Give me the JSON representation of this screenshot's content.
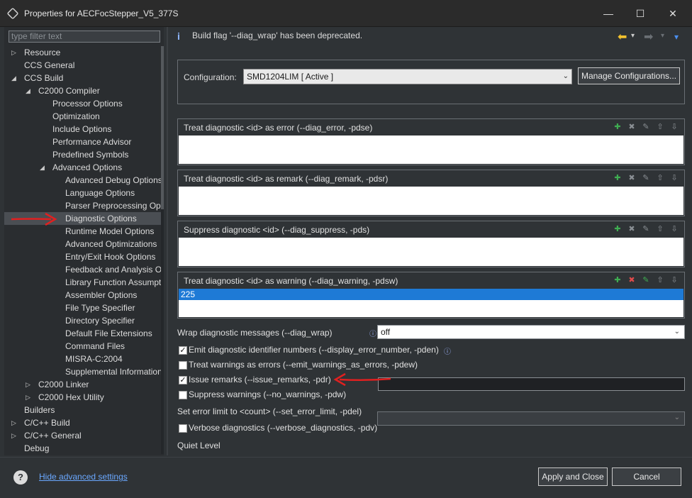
{
  "window": {
    "title": "Properties for AECFocStepper_V5_377S",
    "minimize_glyph": "—",
    "maximize_glyph": "☐",
    "close_glyph": "✕"
  },
  "filter": {
    "placeholder": "type filter text"
  },
  "tree": [
    {
      "label": "Resource",
      "twisty": "▷"
    },
    {
      "label": "CCS General",
      "twisty": ""
    },
    {
      "label": "CCS Build",
      "twisty": "◢"
    },
    {
      "label": "C2000 Compiler",
      "twisty": "◢"
    },
    {
      "label": "Processor Options",
      "twisty": ""
    },
    {
      "label": "Optimization",
      "twisty": ""
    },
    {
      "label": "Include Options",
      "twisty": ""
    },
    {
      "label": "Performance Advisor",
      "twisty": ""
    },
    {
      "label": "Predefined Symbols",
      "twisty": ""
    },
    {
      "label": "Advanced Options",
      "twisty": "◢"
    },
    {
      "label": "Advanced Debug Options",
      "twisty": ""
    },
    {
      "label": "Language Options",
      "twisty": ""
    },
    {
      "label": "Parser Preprocessing Options",
      "twisty": ""
    },
    {
      "label": "Diagnostic Options",
      "twisty": "",
      "selected": true
    },
    {
      "label": "Runtime Model Options",
      "twisty": ""
    },
    {
      "label": "Advanced Optimizations",
      "twisty": ""
    },
    {
      "label": "Entry/Exit Hook Options",
      "twisty": ""
    },
    {
      "label": "Feedback and Analysis Options",
      "twisty": ""
    },
    {
      "label": "Library Function Assumptions",
      "twisty": ""
    },
    {
      "label": "Assembler Options",
      "twisty": ""
    },
    {
      "label": "File Type Specifier",
      "twisty": ""
    },
    {
      "label": "Directory Specifier",
      "twisty": ""
    },
    {
      "label": "Default File Extensions",
      "twisty": ""
    },
    {
      "label": "Command Files",
      "twisty": ""
    },
    {
      "label": "MISRA-C:2004",
      "twisty": ""
    },
    {
      "label": "Supplemental Information",
      "twisty": ""
    },
    {
      "label": "C2000 Linker",
      "twisty": "▷"
    },
    {
      "label": "C2000 Hex Utility",
      "twisty": "▷"
    },
    {
      "label": "Builders",
      "twisty": ""
    },
    {
      "label": "C/C++ Build",
      "twisty": "▷"
    },
    {
      "label": "C/C++ General",
      "twisty": "▷"
    },
    {
      "label": "Debug",
      "twisty": ""
    }
  ],
  "message": {
    "icon": "i",
    "text": "Build flag '--diag_wrap' has been deprecated."
  },
  "nav": {
    "back": "⬅",
    "forward": "➡",
    "menu": "▾"
  },
  "configuration": {
    "label": "Configuration:",
    "value": "SMD1204LIM  [ Active ]",
    "manage_label": "Manage Configurations..."
  },
  "lists": [
    {
      "title": "Treat diagnostic <id> as error (--diag_error, -pdse)",
      "items": []
    },
    {
      "title": "Treat diagnostic <id> as remark (--diag_remark, -pdsr)",
      "items": []
    },
    {
      "title": "Suppress diagnostic <id> (--diag_suppress, -pds)",
      "items": []
    },
    {
      "title": "Treat diagnostic <id> as warning (--diag_warning, -pdsw)",
      "items": [
        "225"
      ]
    }
  ],
  "options": {
    "wrap_label": "Wrap diagnostic messages (--diag_wrap)",
    "wrap_value": "off",
    "emit_label": "Emit diagnostic identifier numbers (--display_error_number, -pden)",
    "emit_checked": true,
    "warnerr_label": "Treat warnings as errors (--emit_warnings_as_errors, -pdew)",
    "warnerr_checked": false,
    "remarks_label": "Issue remarks (--issue_remarks, -pdr)",
    "remarks_checked": true,
    "suppress_label": "Suppress warnings (--no_warnings, -pdw)",
    "suppress_checked": false,
    "errlimit_label": "Set error limit to <count> (--set_error_limit, -pdel)",
    "errlimit_value": "",
    "verbose_label": "Verbose diagnostics (--verbose_diagnostics, -pdv)",
    "verbose_checked": false,
    "quiet_label": "Quiet Level",
    "quiet_value": ""
  },
  "footer": {
    "help": "?",
    "advanced_link": "Hide advanced settings",
    "apply_close": "Apply and Close",
    "cancel": "Cancel"
  },
  "colors": {
    "annotation": "#e02020",
    "selection": "#1e7ad6",
    "link": "#6aa8ff"
  }
}
